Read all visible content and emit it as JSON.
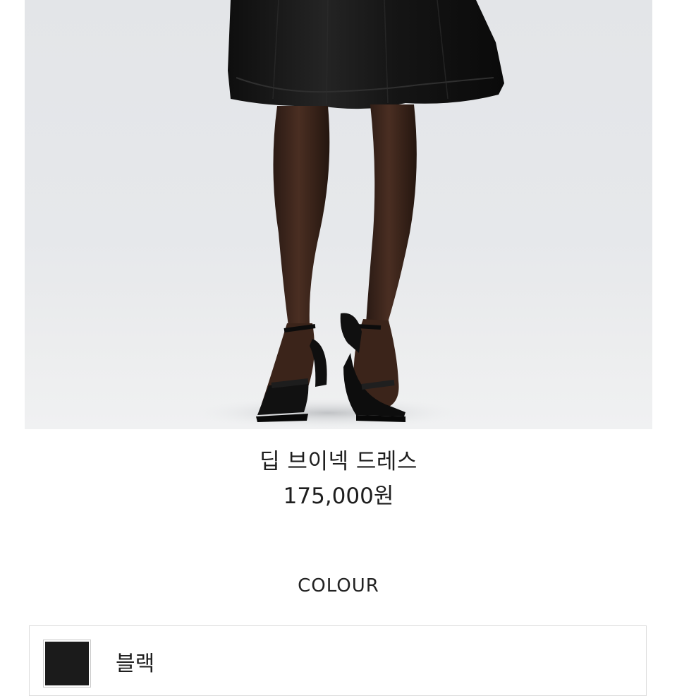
{
  "product": {
    "image_alt": "Model wearing black dress with black heeled sandals",
    "name": "딥 브이넥 드레스",
    "price": "175,000원"
  },
  "colour_section": {
    "heading": "COLOUR",
    "options": [
      {
        "label": "블랙",
        "swatch_color": "#1b1b1b"
      }
    ]
  },
  "colors": {
    "background": "#ffffff",
    "text": "#1e1e1e",
    "border": "#dcdcdc",
    "photo_backdrop": "#e6e8eb"
  }
}
